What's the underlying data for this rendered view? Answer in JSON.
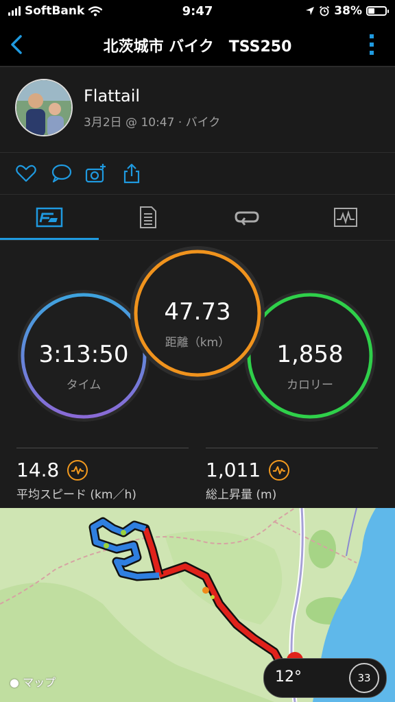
{
  "status_bar": {
    "carrier": "SoftBank",
    "time": "9:47",
    "battery": "38%",
    "battery_level": 0.38
  },
  "header": {
    "title": "北茨城市 バイク　TSS250"
  },
  "profile": {
    "name": "Flattail",
    "subtitle": "3月2日 @ 10:47 · バイク"
  },
  "actions": [
    "heart-icon",
    "comment-icon",
    "add-photo-icon",
    "share-icon"
  ],
  "tabs": [
    {
      "icon": "overview-tab-icon",
      "active": true
    },
    {
      "icon": "details-tab-icon",
      "active": false
    },
    {
      "icon": "laps-tab-icon",
      "active": false
    },
    {
      "icon": "charts-tab-icon",
      "active": false
    }
  ],
  "gauges": {
    "time": {
      "value": "3:13:50",
      "label": "タイム"
    },
    "distance": {
      "value": "47.73",
      "label": "距離（km）"
    },
    "calories": {
      "value": "1,858",
      "label": "カロリー"
    }
  },
  "metrics": {
    "avg_speed": {
      "value": "14.8",
      "label": "平均スピード (km／h)"
    },
    "elevation_gain": {
      "value": "1,011",
      "label": "総上昇量 (m)"
    }
  },
  "map": {
    "logo": "マップ",
    "temperature": "12°",
    "dial_value": "33"
  },
  "colors": {
    "accent": "#1f9ae0",
    "gauge_time": "#5a7bd8",
    "gauge_distance": "#f0931d",
    "gauge_calories": "#2fd04a",
    "map_land": "#c9e1ad",
    "map_water": "#5fb8ea",
    "route_red": "#e0221b"
  }
}
